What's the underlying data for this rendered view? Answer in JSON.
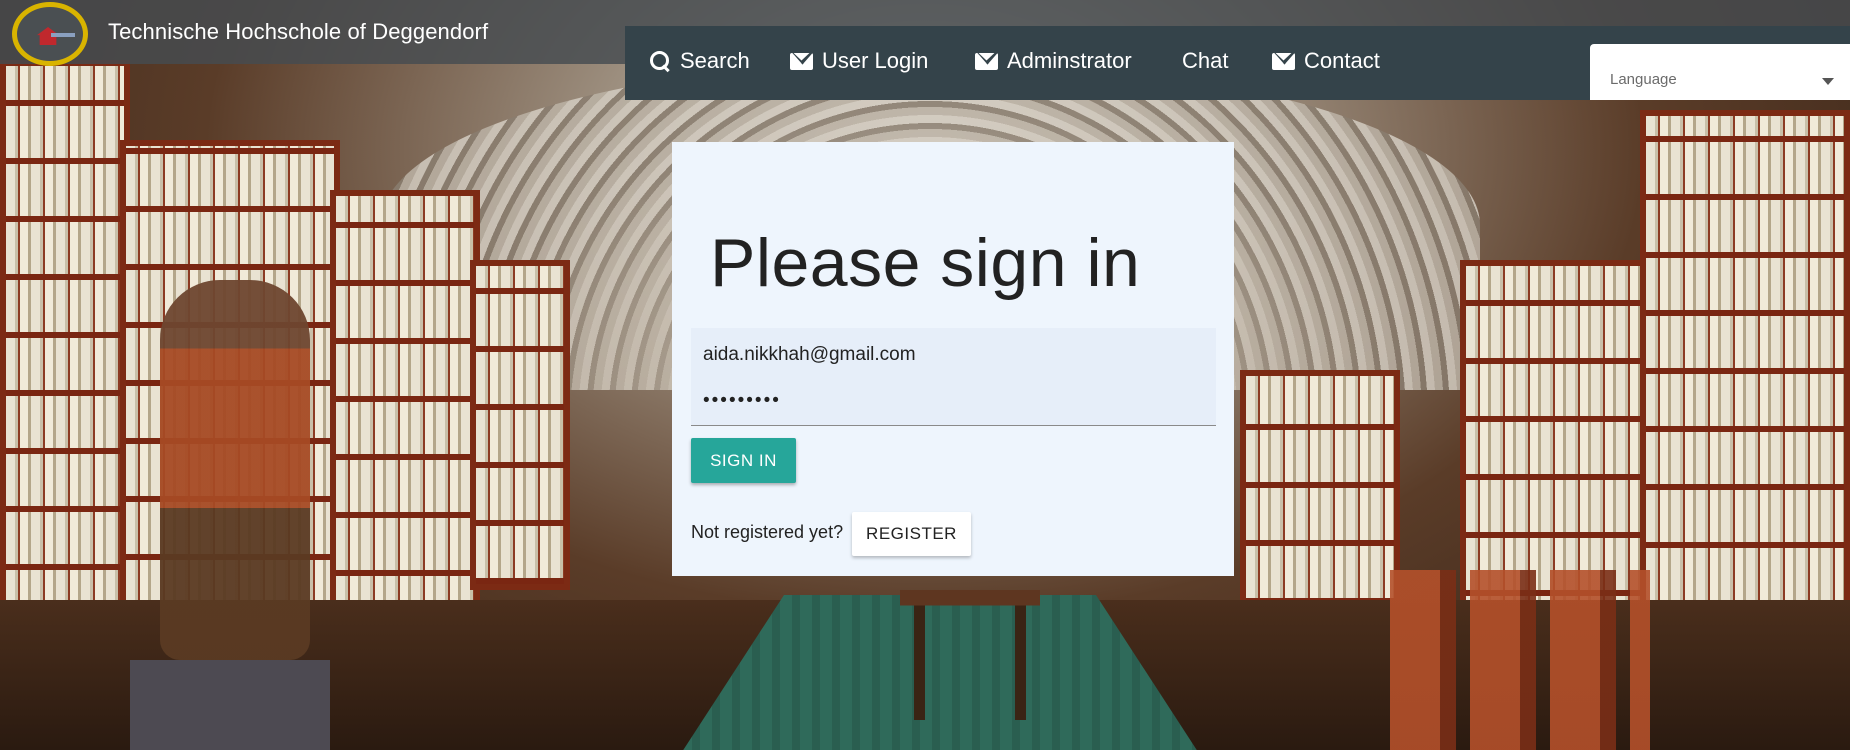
{
  "header": {
    "site_title": "Technische Hochschole of Deggendorf",
    "logo_icon": "university-logo-icon"
  },
  "nav": {
    "items": [
      {
        "label": "Search",
        "icon": "search-icon"
      },
      {
        "label": "User Login",
        "icon": "envelope-icon"
      },
      {
        "label": "Adminstrator",
        "icon": "envelope-icon"
      },
      {
        "label": "Chat",
        "icon": ""
      },
      {
        "label": "Contact",
        "icon": "envelope-icon"
      }
    ]
  },
  "language_select": {
    "placeholder": "Language"
  },
  "signin": {
    "title": "Please sign in",
    "email_value": "aida.nikkhah@gmail.com",
    "password_value": "•••••••••",
    "signin_label": "SIGN IN",
    "not_registered_text": "Not registered yet?",
    "register_label": "REGISTER"
  },
  "colors": {
    "navbar_bg": "#34434a",
    "header_strip": "#464c50",
    "signin_button": "#26a69a",
    "card_bg": "#eef5fd",
    "logo_ring": "#d9b400"
  }
}
